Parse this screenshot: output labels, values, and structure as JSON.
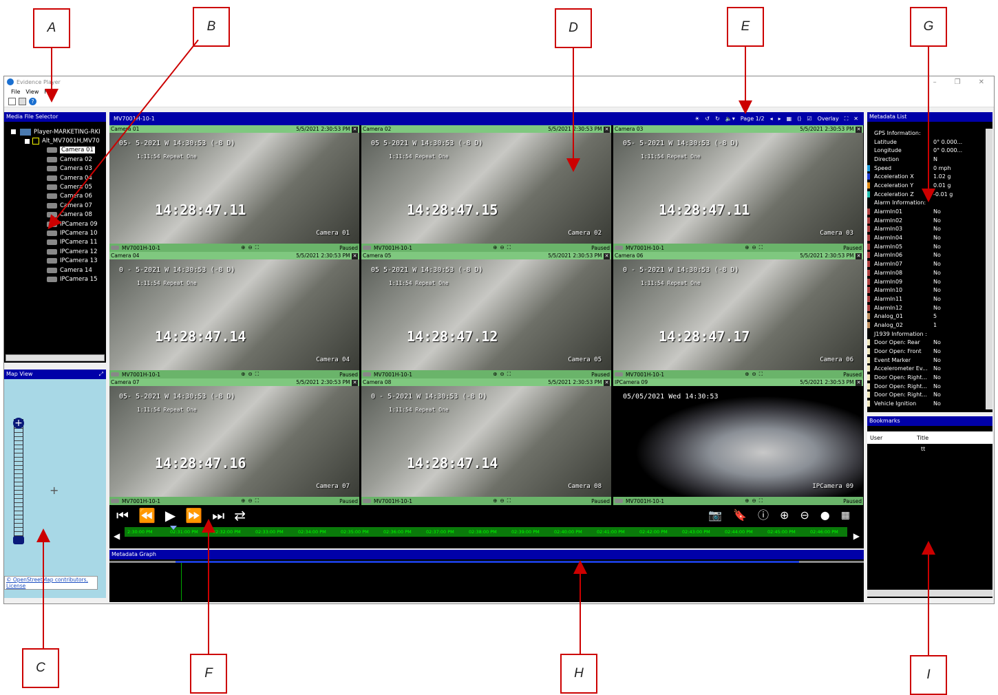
{
  "callouts": [
    "A",
    "B",
    "C",
    "D",
    "E",
    "F",
    "G",
    "H",
    "I"
  ],
  "window": {
    "title": "Evidence Player",
    "menu": [
      "File",
      "View",
      "Help"
    ]
  },
  "media_selector": {
    "title": "Media File Selector",
    "root": "Player-MARKETING-RKI",
    "folder": "Alt_MV7001H,MV70",
    "cameras": [
      "Camera 01",
      "Camera 02",
      "Camera 03",
      "Camera 04",
      "Camera 05",
      "Camera 06",
      "Camera 07",
      "Camera 08",
      "IPCamera 09",
      "IPCamera 10",
      "IPCamera 11",
      "IPCamera 12",
      "IPCamera 13",
      "Camera 14",
      "IPCamera 15"
    ],
    "selected": "Camera 01"
  },
  "map": {
    "title": "Map View",
    "attribution": "© OpenStreetMap contributors,",
    "license": "License"
  },
  "video": {
    "device": "MV7001H-10-1",
    "page": "Page 1/2",
    "overlay": "Overlay",
    "cells": [
      {
        "name": "Camera 01",
        "date": "5/5/2021 2:30:53 PM",
        "ts": "14:28:47.11",
        "osd_top": "05- 5-2021 W 14:30:53 (-8 D)",
        "src": "MV7001H-10-1",
        "status": "Paused"
      },
      {
        "name": "Camera 02",
        "date": "5/5/2021 2:30:53 PM",
        "ts": "14:28:47.15",
        "osd_top": "05 5-2021 W 14:30:53 (-8 D)",
        "src": "MV7001H-10-1",
        "status": "Paused"
      },
      {
        "name": "Camera 03",
        "date": "5/5/2021 2:30:53 PM",
        "ts": "14:28:47.11",
        "osd_top": "05- 5-2021 W 14:30:53 (-8 D)",
        "src": "MV7001H-10-1",
        "status": "Paused"
      },
      {
        "name": "Camera 04",
        "date": "5/5/2021 2:30:53 PM",
        "ts": "14:28:47.14",
        "osd_top": "0 - 5-2021 W 14:30:53 (-8 D)",
        "src": "MV7001H-10-1",
        "status": "Paused"
      },
      {
        "name": "Camera 05",
        "date": "5/5/2021 2:30:53 PM",
        "ts": "14:28:47.12",
        "osd_top": "05 5-2021 W 14:30:53 (-8 D)",
        "src": "MV7001H-10-1",
        "status": "Paused"
      },
      {
        "name": "Camera 06",
        "date": "5/5/2021 2:30:53 PM",
        "ts": "14:28:47.17",
        "osd_top": "0 - 5-2021 W 14:30:53 (-8 D)",
        "src": "MV7001H-10-1",
        "status": "Paused"
      },
      {
        "name": "Camera 07",
        "date": "5/5/2021 2:30:53 PM",
        "ts": "14:28:47.16",
        "osd_top": "05- 5-2021 W 14:30:53 (-8 D)",
        "src": "MV7001H-10-1",
        "status": "Paused"
      },
      {
        "name": "Camera 08",
        "date": "5/5/2021 2:30:53 PM",
        "ts": "14:28:47.14",
        "osd_top": "0 - 5-2021 W 14:30:53 (-8 D)",
        "src": "MV7001H-10-1",
        "status": "Paused"
      },
      {
        "name": "IPCamera 09",
        "date": "5/5/2021 2:30:53 PM",
        "ts": "",
        "osd_top": "05/05/2021 Wed 14:30:53",
        "src": "MV7001H-10-1",
        "status": "Paused"
      }
    ],
    "osd_sub": "1:11:54  Repeat One",
    "osd_labels": [
      "Camera 01",
      "Camera 02",
      "Camera 03",
      "Camera 04",
      "Camera 05",
      "Camera 06",
      "Camera 07",
      "Camera 08",
      "IPCamera 09"
    ]
  },
  "timeline": {
    "ticks": [
      "2:30:00 PM",
      "02:31:00 PM",
      "02:32:00 PM",
      "02:33:00 PM",
      "02:34:00 PM",
      "02:35:00 PM",
      "02:36:00 PM",
      "02:37:00 PM",
      "02:38:00 PM",
      "02:39:00 PM",
      "02:40:00 PM",
      "02:41:00 PM",
      "02:42:00 PM",
      "02:43:00 PM",
      "02:44:00 PM",
      "02:45:00 PM",
      "02:46:00 PM"
    ]
  },
  "graph": {
    "title": "Metadata Graph"
  },
  "metadata": {
    "title": "Metadata List",
    "rows": [
      [
        "GPS Information:",
        "",
        "none"
      ],
      [
        "Latitude",
        "0° 0.000...",
        "none"
      ],
      [
        "Longitude",
        "0° 0.000...",
        "none"
      ],
      [
        "Direction",
        "N",
        "none"
      ],
      [
        "Speed",
        "0 mph",
        "#1ea0e0"
      ],
      [
        "Acceleration X",
        "1.02 g",
        "#1a3cd8"
      ],
      [
        "Acceleration Y",
        "0.01 g",
        "#e08a10"
      ],
      [
        "Acceleration Z",
        "-0.01 g",
        "#20c0b0"
      ],
      [
        "Alarm Information:",
        "",
        "none"
      ],
      [
        "AlarmIn01",
        "No",
        "#b04040"
      ],
      [
        "AlarmIn02",
        "No",
        "#b04040"
      ],
      [
        "AlarmIn03",
        "No",
        "#b04040"
      ],
      [
        "AlarmIn04",
        "No",
        "#b04040"
      ],
      [
        "AlarmIn05",
        "No",
        "#b04040"
      ],
      [
        "AlarmIn06",
        "No",
        "#b04040"
      ],
      [
        "AlarmIn07",
        "No",
        "#b04040"
      ],
      [
        "AlarmIn08",
        "No",
        "#b04040"
      ],
      [
        "AlarmIn09",
        "No",
        "#b04040"
      ],
      [
        "AlarmIn10",
        "No",
        "#b04040"
      ],
      [
        "AlarmIn11",
        "No",
        "#b04040"
      ],
      [
        "AlarmIn12",
        "No",
        "#b04040"
      ],
      [
        "Analog_01",
        "5",
        "#c09060"
      ],
      [
        "Analog_02",
        "1",
        "#c09060"
      ],
      [
        "J1939 Information :",
        "",
        "none"
      ],
      [
        "Door Open: Rear",
        "No",
        "#f0e8c0"
      ],
      [
        "Door Open: Front",
        "No",
        "#f0e8c0"
      ],
      [
        "Event Marker",
        "No",
        "#f0e8c0"
      ],
      [
        "Accelerometer Ev...",
        "No",
        "#f0e8c0"
      ],
      [
        "Door Open: Right...",
        "No",
        "#f0e8c0"
      ],
      [
        "Door Open: Right...",
        "No",
        "#f0e8c0"
      ],
      [
        "Door Open: Right...",
        "No",
        "#f0e8c0"
      ],
      [
        "Vehicle Ignition",
        "No",
        "#f0e8c0"
      ]
    ]
  },
  "bookmarks": {
    "title": "Bookmarks",
    "col_user": "User",
    "col_title": "Title",
    "rows": [
      [
        "",
        "tt"
      ]
    ]
  }
}
